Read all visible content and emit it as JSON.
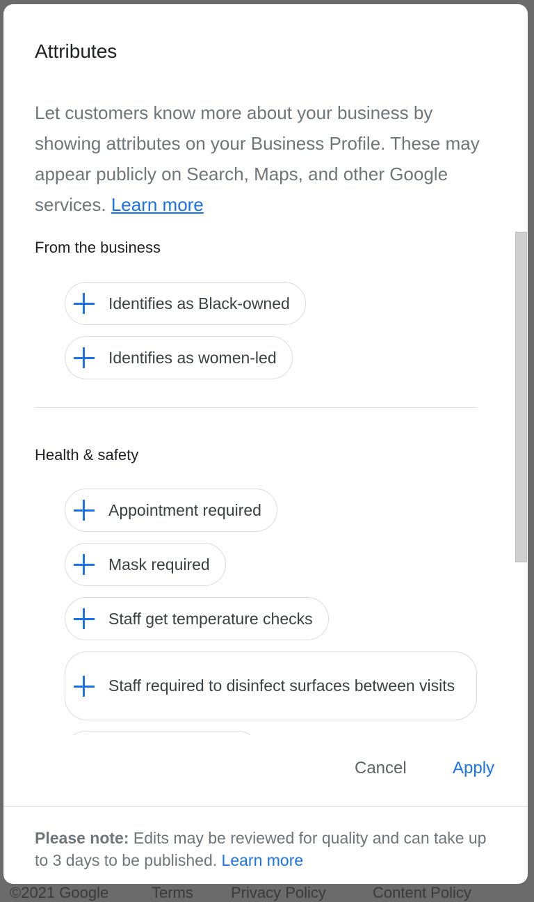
{
  "dialog": {
    "title": "Attributes",
    "description": "Let customers know more about your business by showing attributes on your Business Profile. These may appear publicly on Search, Maps, and other Google services.",
    "learn_more": "Learn more",
    "sections": [
      {
        "title": "From the business",
        "chips": [
          {
            "label": "Identifies as Black-owned",
            "icon": "plus-icon"
          },
          {
            "label": "Identifies as women-led",
            "icon": "plus-icon"
          }
        ]
      },
      {
        "title": "Health & safety",
        "chips": [
          {
            "label": "Appointment required",
            "icon": "plus-icon"
          },
          {
            "label": "Mask required",
            "icon": "plus-icon"
          },
          {
            "label": "Staff get temperature checks",
            "icon": "plus-icon"
          },
          {
            "label": "Staff required to disinfect surfaces between visits",
            "icon": "plus-icon"
          }
        ]
      }
    ],
    "actions": {
      "cancel": "Cancel",
      "apply": "Apply"
    },
    "note": {
      "bold": "Please note:",
      "text": " Edits may be reviewed for quality and can take up to 3 days to be published.",
      "learn_more": "Learn more"
    }
  },
  "background_footer": [
    "©2021 Google",
    "Terms",
    "Privacy Policy",
    "Content Policy"
  ],
  "colors": {
    "accent": "#1a73e8",
    "text_primary": "#202124",
    "text_secondary": "#70757a"
  }
}
